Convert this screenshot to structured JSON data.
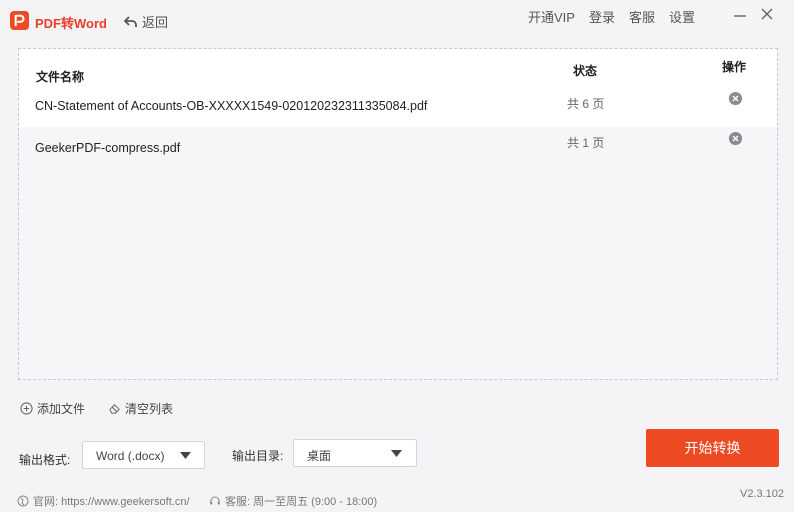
{
  "header": {
    "app_title": "PDF转Word",
    "back_label": "返回",
    "nav": [
      "开通VIP",
      "登录",
      "客服",
      "设置"
    ]
  },
  "table": {
    "columns": [
      "文件名称",
      "状态",
      "操作"
    ],
    "rows": [
      {
        "name": "CN-Statement of Accounts-OB-XXXXX1549-020120232311335084.pdf",
        "pages": "共 6 页"
      },
      {
        "name": "GeekerPDF-compress.pdf",
        "pages": "共 1 页"
      }
    ]
  },
  "actions": {
    "add_file": "添加文件",
    "clear_list": "清空列表"
  },
  "output": {
    "format_label": "输出格式:",
    "format_value": "Word (.docx)",
    "dir_label": "输出目录:",
    "dir_value": "桌面"
  },
  "start_button": "开始转换",
  "footer": {
    "website": "官网: https://www.geekersoft.cn/",
    "service": "客服: 周一至周五 (9:00 - 18:00)",
    "version": "V2.3.102"
  },
  "colors": {
    "accent": "#ee4b24",
    "background": "#f4f4f6"
  }
}
